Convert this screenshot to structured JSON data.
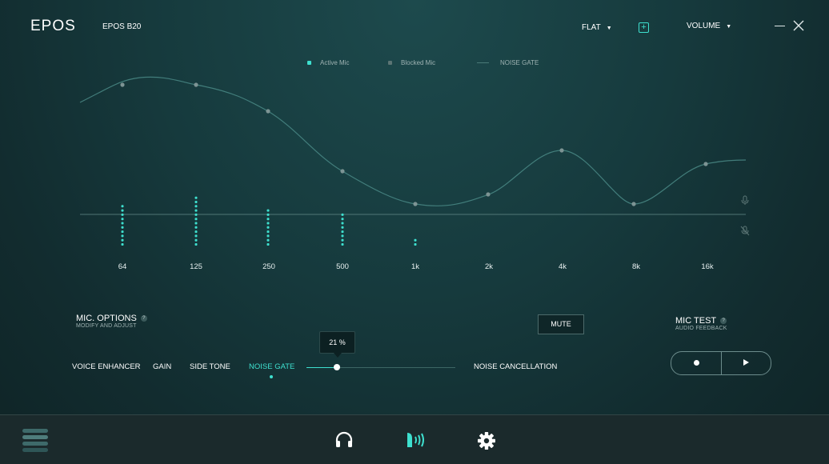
{
  "app": {
    "logo": "EPOS",
    "device": "EPOS B20"
  },
  "header": {
    "preset_label": "FLAT",
    "volume_label": "VOLUME"
  },
  "legend": {
    "active": "Active Mic",
    "blocked": "Blocked Mic",
    "noise_gate": "NOISE GATE"
  },
  "frequencies": [
    "64",
    "125",
    "250",
    "500",
    "1k",
    "2k",
    "4k",
    "8k",
    "16k"
  ],
  "mic_levels": [
    10,
    12,
    9,
    8,
    2,
    0,
    0,
    0,
    0
  ],
  "colors": {
    "accent": "#3ee0cf",
    "curve": "#4a8a86",
    "point": "#7d9494"
  },
  "mic_options": {
    "title": "MIC. OPTIONS",
    "subtitle": "MODIFY AND ADJUST",
    "help": "?"
  },
  "options": [
    {
      "label": "VOICE ENHANCER",
      "active": false
    },
    {
      "label": "GAIN",
      "active": false
    },
    {
      "label": "SIDE TONE",
      "active": false
    },
    {
      "label": "NOISE GATE",
      "active": true
    },
    {
      "label": "NOISE CANCELLATION",
      "active": false
    }
  ],
  "noise_gate": {
    "value_label": "21 %",
    "value_percent": 21
  },
  "mute_label": "MUTE",
  "mic_test": {
    "title": "MIC TEST",
    "subtitle": "AUDIO FEEDBACK",
    "help": "?"
  },
  "icons": {
    "add": "plus-square-icon",
    "minimize": "minimize-icon",
    "close": "close-icon",
    "menu": "menu-icon",
    "headset": "headset-icon",
    "mic": "microphone-icon",
    "settings": "gear-icon"
  }
}
